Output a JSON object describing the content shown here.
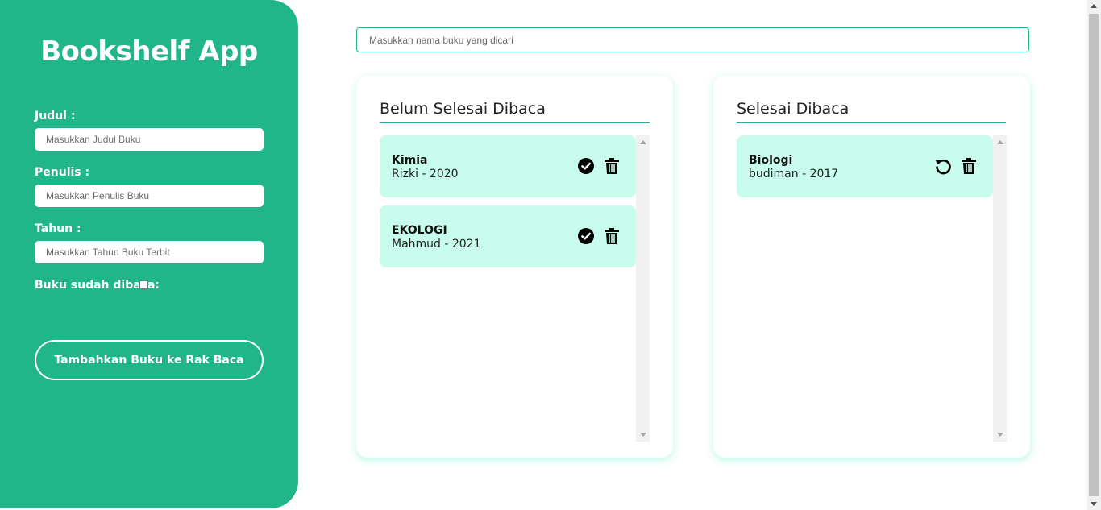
{
  "app": {
    "title": "Bookshelf App"
  },
  "form": {
    "judul_label": "Judul :",
    "judul_placeholder": "Masukkan Judul Buku",
    "penulis_label": "Penulis :",
    "penulis_placeholder": "Masukkan Penulis Buku",
    "tahun_label": "Tahun :",
    "tahun_placeholder": "Masukkan Tahun Buku Terbit",
    "checkbox_label": "Buku sudah dibaca:",
    "checkbox_checked": false,
    "submit_label": "Tambahkan Buku ke Rak Baca"
  },
  "search": {
    "placeholder": "Masukkan nama buku yang dicari"
  },
  "shelves": {
    "unread": {
      "title": "Belum Selesai Dibaca",
      "books": [
        {
          "title": "Kimia",
          "meta": "Rizki - 2020",
          "action_icon": "check-circle-icon",
          "delete_icon": "trash-icon"
        },
        {
          "title": "EKOLOGI",
          "meta": "Mahmud - 2021",
          "action_icon": "check-circle-icon",
          "delete_icon": "trash-icon"
        }
      ]
    },
    "read": {
      "title": "Selesai Dibaca",
      "books": [
        {
          "title": "Biologi",
          "meta": "budiman - 2017",
          "action_icon": "undo-icon",
          "delete_icon": "trash-icon"
        }
      ]
    }
  },
  "colors": {
    "primary": "#20b68a",
    "card": "#c8fcec",
    "divider": "#3aa6a0"
  }
}
